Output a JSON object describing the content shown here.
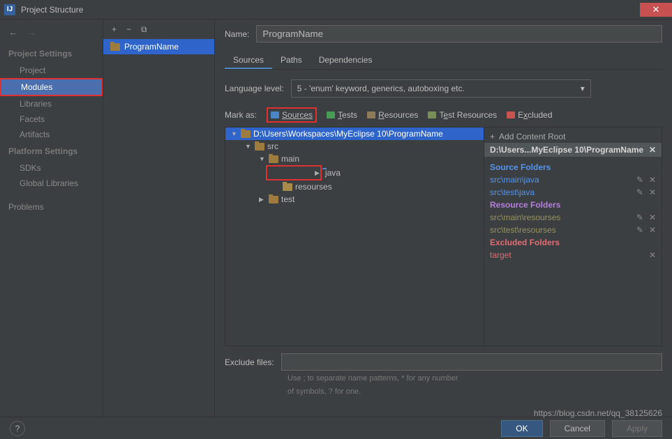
{
  "window": {
    "title": "Project Structure"
  },
  "sidebar": {
    "back_enabled": true,
    "heading1": "Project Settings",
    "heading2": "Platform Settings",
    "items1": [
      "Project",
      "Modules",
      "Libraries",
      "Facets",
      "Artifacts"
    ],
    "items2": [
      "SDKs",
      "Global Libraries"
    ],
    "problems": "Problems"
  },
  "module_list": {
    "module": "ProgramName"
  },
  "content": {
    "name_label": "Name:",
    "name_value": "ProgramName",
    "tabs": [
      "Sources",
      "Paths",
      "Dependencies"
    ],
    "lang_label": "Language level:",
    "lang_value": "5 - 'enum' keyword, generics, autoboxing etc.",
    "mark_label": "Mark as:",
    "marks": {
      "sources": "Sources",
      "tests": "Tests",
      "resources": "Resources",
      "testres": "Test Resources",
      "excluded": "Excluded"
    },
    "tree": {
      "root": "D:\\Users\\Workspaces\\MyEclipse 10\\ProgramName",
      "src": "src",
      "main": "main",
      "java": "java",
      "resourses": "resourses",
      "test": "test"
    },
    "right": {
      "add_root": "Add Content Root",
      "path": "D:\\Users...MyEclipse 10\\ProgramName",
      "source_title": "Source Folders",
      "source_items": [
        "src\\main\\java",
        "src\\test\\java"
      ],
      "resource_title": "Resource Folders",
      "resource_items": [
        "src\\main\\resourses",
        "src\\test\\resourses"
      ],
      "excluded_title": "Excluded Folders",
      "excluded_items": [
        "target"
      ]
    },
    "exclude_label": "Exclude files:",
    "hint1": "Use ; to separate name patterns, * for any number",
    "hint2": "of symbols, ? for one."
  },
  "footer": {
    "ok": "OK",
    "cancel": "Cancel",
    "apply": "Apply"
  },
  "watermark": "https://blog.csdn.net/qq_38125626"
}
